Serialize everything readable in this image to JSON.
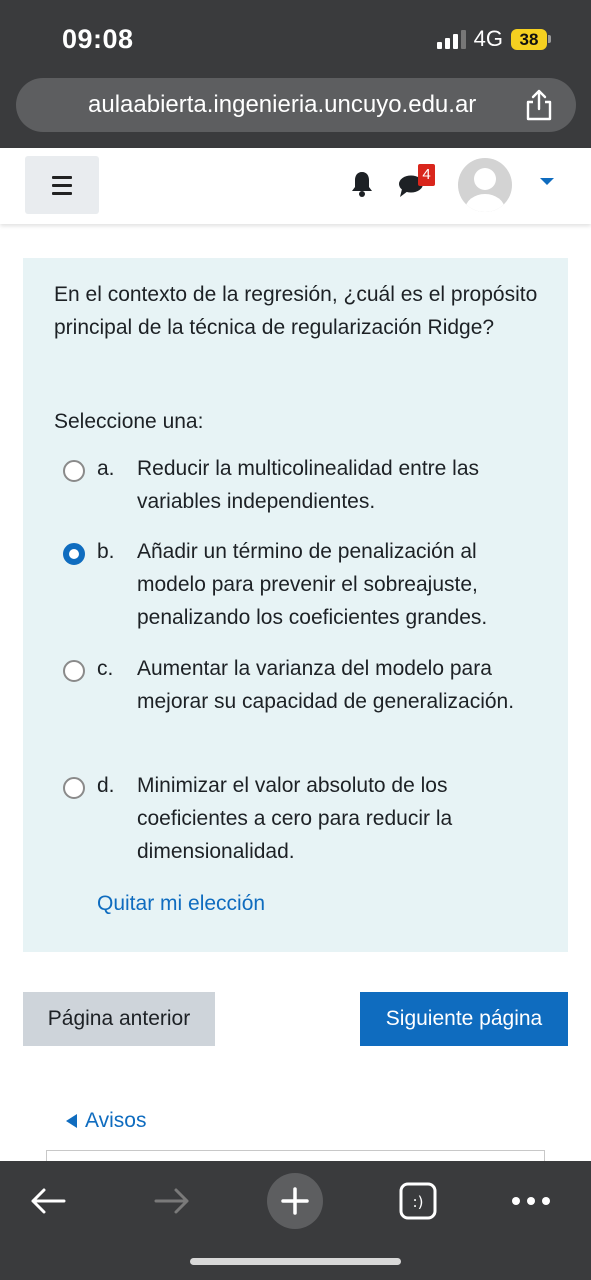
{
  "status": {
    "time": "09:08",
    "network": "4G",
    "battery": "38"
  },
  "browser": {
    "url": "aulaabierta.ingenieria.uncuyo.edu.ar"
  },
  "header": {
    "message_count": "4"
  },
  "question": {
    "text": "En el contexto de la regresión, ¿cuál es el propósito principal de la técnica de regularización Ridge?",
    "prompt": "Seleccione una:",
    "options": [
      {
        "letter": "a.",
        "text": "Reducir la multicolinealidad entre las variables independientes.",
        "selected": false
      },
      {
        "letter": "b.",
        "text": "Añadir un término de penalización al modelo para prevenir el sobreajuste, penalizando los coeficientes grandes.",
        "selected": true
      },
      {
        "letter": "c.",
        "text": "Aumentar la varianza del modelo para mejorar su capacidad de generalización.",
        "selected": false
      },
      {
        "letter": "d.",
        "text": "Minimizar el valor absoluto de los coeficientes a cero para reducir la dimensionalidad.",
        "selected": false
      }
    ],
    "clear_label": "Quitar mi elección"
  },
  "nav": {
    "prev_label": "Página anterior",
    "next_label": "Siguiente página"
  },
  "footer": {
    "avisos_label": "Avisos"
  },
  "colors": {
    "accent": "#0f6cbf",
    "card_bg": "#e7f3f5",
    "badge": "#d9261c",
    "chrome": "#3a3b3d"
  },
  "icons": [
    "hamburger-icon",
    "bell-icon",
    "chat-icon",
    "avatar",
    "share-icon",
    "back-arrow-icon",
    "forward-arrow-icon",
    "plus-icon",
    "tabs-icon",
    "more-icon"
  ]
}
